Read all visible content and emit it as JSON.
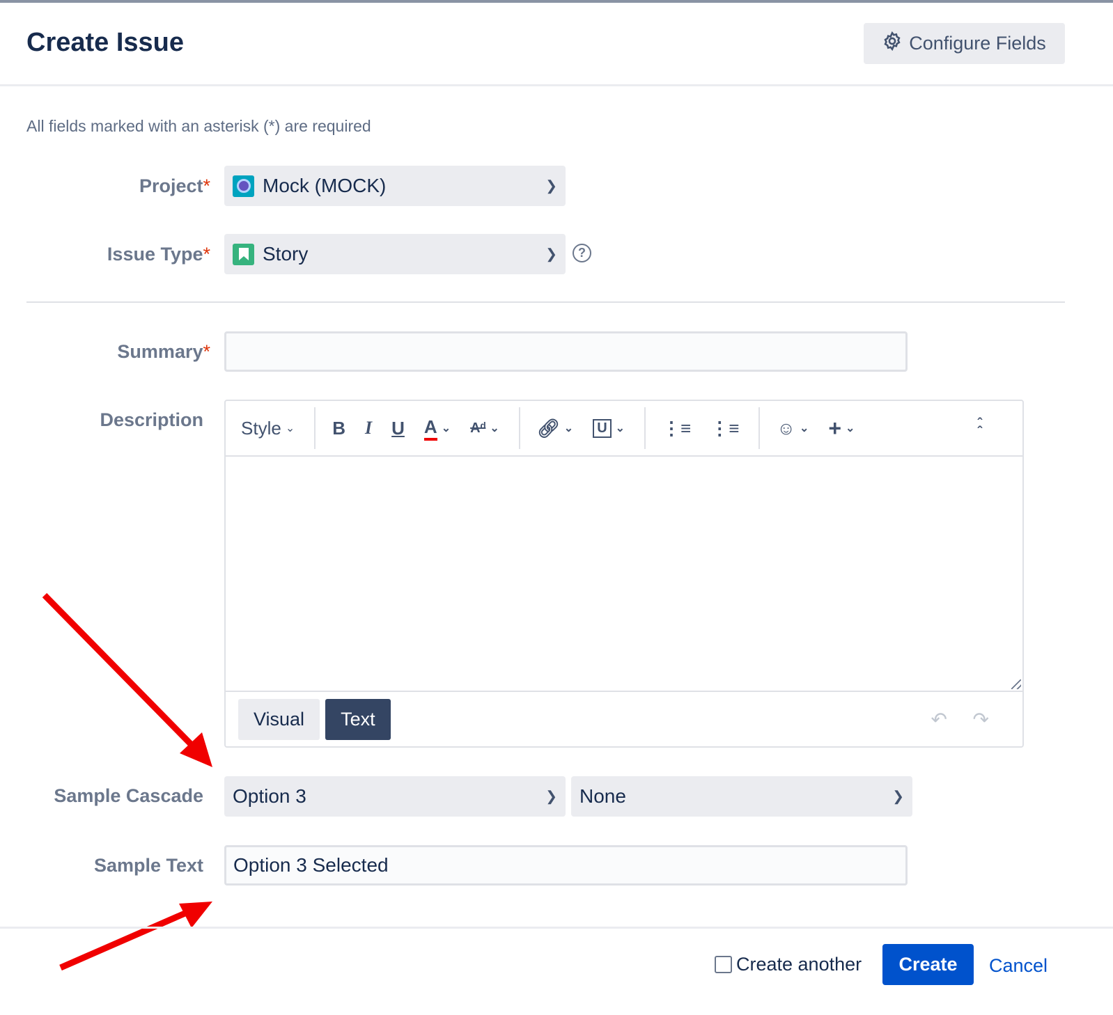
{
  "header": {
    "title": "Create Issue",
    "configure_label": "Configure Fields"
  },
  "required_note": "All fields marked with an asterisk (*) are required",
  "fields": {
    "project": {
      "label": "Project",
      "value": "Mock (MOCK)"
    },
    "issue_type": {
      "label": "Issue Type",
      "value": "Story"
    },
    "summary": {
      "label": "Summary",
      "value": ""
    },
    "description": {
      "label": "Description",
      "style_label": "Style",
      "visual_label": "Visual",
      "text_label": "Text"
    },
    "cascade": {
      "label": "Sample Cascade",
      "parent": "Option 3",
      "child": "None"
    },
    "sample_text": {
      "label": "Sample Text",
      "value": "Option 3 Selected"
    }
  },
  "asterisk": "*",
  "footer": {
    "create_another": "Create another",
    "create_label": "Create",
    "cancel_label": "Cancel"
  },
  "colors": {
    "primary": "#0052cc",
    "annotation_arrow": "#f00000"
  }
}
